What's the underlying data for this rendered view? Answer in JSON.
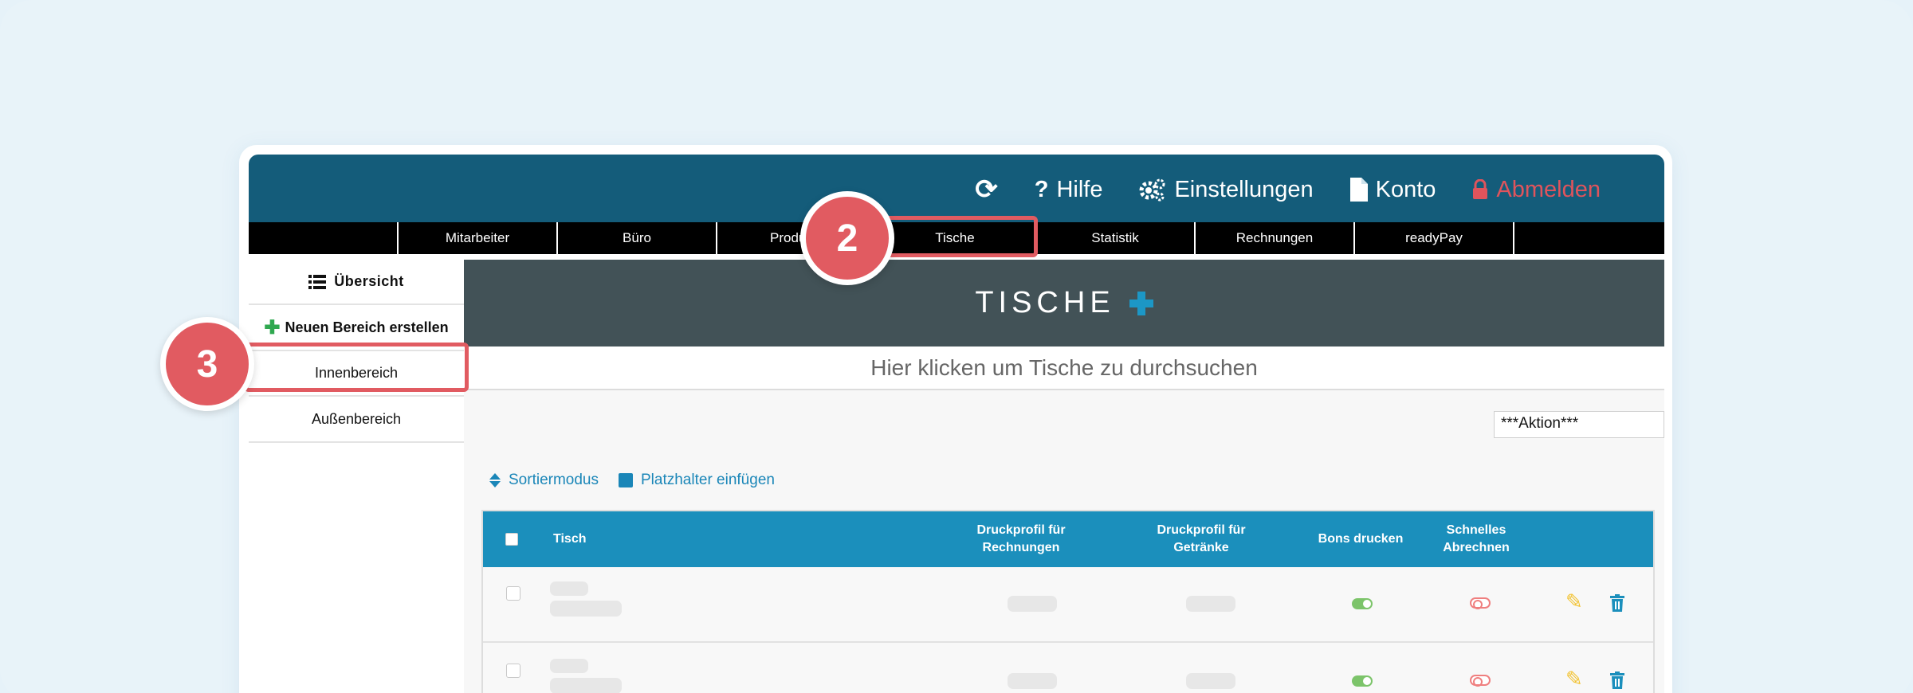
{
  "topbar": {
    "refresh_icon": "refresh-icon",
    "help_label": "Hilfe",
    "settings_label": "Einstellungen",
    "account_label": "Konto",
    "logout_label": "Abmelden"
  },
  "menu": {
    "items": [
      "Mitarbeiter",
      "Büro",
      "Produ",
      "Tische",
      "Statistik",
      "Rechnungen",
      "readyPay"
    ]
  },
  "sidebar": {
    "overview_label": "Übersicht",
    "new_area_label": "Neuen Bereich erstellen",
    "areas": [
      "Innenbereich",
      "Außenbereich"
    ]
  },
  "main": {
    "title": "TISCHE",
    "search_placeholder": "Hier klicken um Tische zu durchsuchen",
    "action_select": "***Aktion***",
    "sort_label": "Sortiermodus",
    "placeholder_label": "Platzhalter einfügen"
  },
  "table": {
    "columns": {
      "table": "Tisch",
      "print_invoices": "Druckprofil für Rechnungen",
      "print_drinks": "Druckprofil für Getränke",
      "print_receipts": "Bons drucken",
      "quick_checkout": "Schnelles Abrechnen"
    },
    "rows": [
      {
        "bons_drucken": true,
        "schnelles_abrechnen": false
      },
      {
        "bons_drucken": true,
        "schnelles_abrechnen": false
      }
    ]
  },
  "callouts": {
    "step_2": "2",
    "step_3": "3"
  },
  "colors": {
    "topbar": "#145c7a",
    "accent": "#1b8fbc",
    "highlight": "#e15b61",
    "logout": "#e0545c"
  }
}
